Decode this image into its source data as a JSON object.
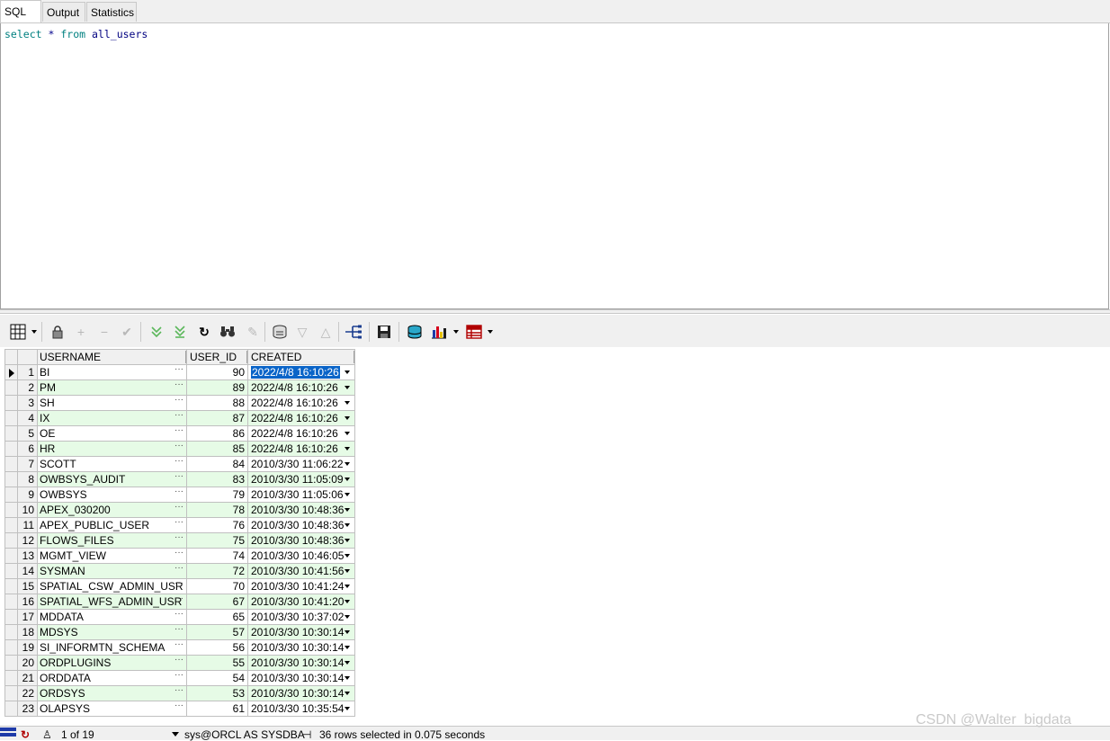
{
  "tabs": [
    "SQL",
    "Output",
    "Statistics"
  ],
  "editor": {
    "sql_keyword_select": "select",
    "sql_star": "*",
    "sql_keyword_from": "from",
    "sql_table": "all_users"
  },
  "toolbar_icons": [
    "grid-view-icon",
    "lock-icon",
    "add-record-icon",
    "delete-record-icon",
    "post-changes-icon",
    "fetch-next-icon",
    "fetch-last-icon",
    "refresh-icon",
    "find-icon",
    "clear-icon",
    "query-by-example-icon",
    "sort-descending-icon",
    "sort-ascending-icon",
    "explain-plan-icon",
    "save-icon",
    "export-icon",
    "chart-icon",
    "print-icon"
  ],
  "grid": {
    "columns": [
      "USERNAME",
      "USER_ID",
      "CREATED"
    ],
    "rows": [
      {
        "no": "1",
        "username": "BI",
        "user_id": "90",
        "created": "2022/4/8 16:10:26"
      },
      {
        "no": "2",
        "username": "PM",
        "user_id": "89",
        "created": "2022/4/8 16:10:26"
      },
      {
        "no": "3",
        "username": "SH",
        "user_id": "88",
        "created": "2022/4/8 16:10:26"
      },
      {
        "no": "4",
        "username": "IX",
        "user_id": "87",
        "created": "2022/4/8 16:10:26"
      },
      {
        "no": "5",
        "username": "OE",
        "user_id": "86",
        "created": "2022/4/8 16:10:26"
      },
      {
        "no": "6",
        "username": "HR",
        "user_id": "85",
        "created": "2022/4/8 16:10:26"
      },
      {
        "no": "7",
        "username": "SCOTT",
        "user_id": "84",
        "created": "2010/3/30 11:06:22"
      },
      {
        "no": "8",
        "username": "OWBSYS_AUDIT",
        "user_id": "83",
        "created": "2010/3/30 11:05:09"
      },
      {
        "no": "9",
        "username": "OWBSYS",
        "user_id": "79",
        "created": "2010/3/30 11:05:06"
      },
      {
        "no": "10",
        "username": "APEX_030200",
        "user_id": "78",
        "created": "2010/3/30 10:48:36"
      },
      {
        "no": "11",
        "username": "APEX_PUBLIC_USER",
        "user_id": "76",
        "created": "2010/3/30 10:48:36"
      },
      {
        "no": "12",
        "username": "FLOWS_FILES",
        "user_id": "75",
        "created": "2010/3/30 10:48:36"
      },
      {
        "no": "13",
        "username": "MGMT_VIEW",
        "user_id": "74",
        "created": "2010/3/30 10:46:05"
      },
      {
        "no": "14",
        "username": "SYSMAN",
        "user_id": "72",
        "created": "2010/3/30 10:41:56"
      },
      {
        "no": "15",
        "username": "SPATIAL_CSW_ADMIN_USR",
        "user_id": "70",
        "created": "2010/3/30 10:41:24"
      },
      {
        "no": "16",
        "username": "SPATIAL_WFS_ADMIN_USR",
        "user_id": "67",
        "created": "2010/3/30 10:41:20"
      },
      {
        "no": "17",
        "username": "MDDATA",
        "user_id": "65",
        "created": "2010/3/30 10:37:02"
      },
      {
        "no": "18",
        "username": "MDSYS",
        "user_id": "57",
        "created": "2010/3/30 10:30:14"
      },
      {
        "no": "19",
        "username": "SI_INFORMTN_SCHEMA",
        "user_id": "56",
        "created": "2010/3/30 10:30:14"
      },
      {
        "no": "20",
        "username": "ORDPLUGINS",
        "user_id": "55",
        "created": "2010/3/30 10:30:14"
      },
      {
        "no": "21",
        "username": "ORDDATA",
        "user_id": "54",
        "created": "2010/3/30 10:30:14"
      },
      {
        "no": "22",
        "username": "ORDSYS",
        "user_id": "53",
        "created": "2010/3/30 10:30:14"
      },
      {
        "no": "23",
        "username": "OLAPSYS",
        "user_id": "61",
        "created": "2010/3/30 10:35:54"
      }
    ]
  },
  "status": {
    "position": "1 of 19",
    "connection": "sys@ORCL AS SYSDBA",
    "message": "36 rows selected in 0.075 seconds"
  },
  "watermark": "CSDN @Walter_bigdata",
  "colors": {
    "even_row": "#e6fbe6",
    "selection": "#0a64c8",
    "keyword": "#008080"
  }
}
